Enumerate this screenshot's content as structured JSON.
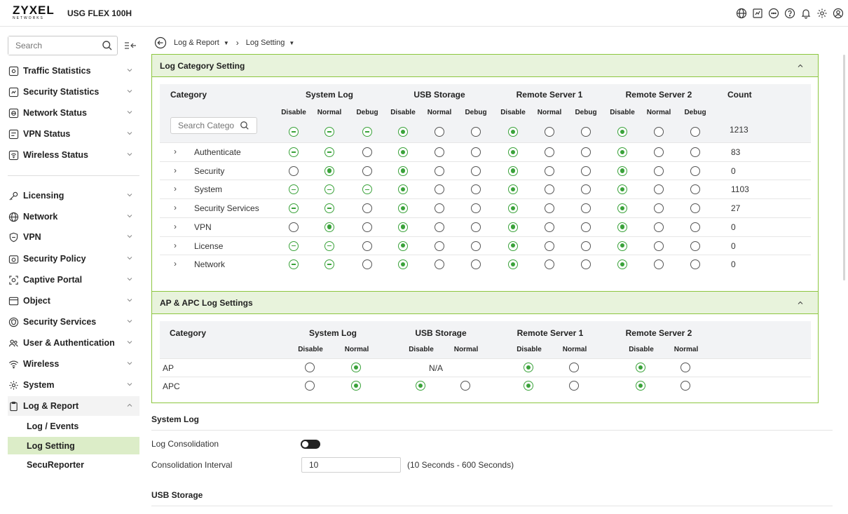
{
  "header": {
    "brand": "ZYXEL",
    "brand_sub": "NETWORKS",
    "model": "USG FLEX 100H",
    "icons": [
      "globe-icon",
      "terminal-icon",
      "chat-icon",
      "help-icon",
      "bell-icon",
      "gear-icon",
      "user-icon"
    ]
  },
  "sidebar": {
    "search_placeholder": "Search",
    "monitor_items": [
      {
        "label": "Traffic Statistics",
        "icon": "chart-icon"
      },
      {
        "label": "Security Statistics",
        "icon": "shield-chart-icon"
      },
      {
        "label": "Network Status",
        "icon": "network-status-icon"
      },
      {
        "label": "VPN Status",
        "icon": "vpn-status-icon"
      },
      {
        "label": "Wireless Status",
        "icon": "wireless-status-icon"
      }
    ],
    "config_items": [
      {
        "label": "Licensing",
        "icon": "key-icon"
      },
      {
        "label": "Network",
        "icon": "globe-icon"
      },
      {
        "label": "VPN",
        "icon": "vpn-shield-icon"
      },
      {
        "label": "Security Policy",
        "icon": "policy-icon"
      },
      {
        "label": "Captive Portal",
        "icon": "portal-icon"
      },
      {
        "label": "Object",
        "icon": "object-icon"
      },
      {
        "label": "Security Services",
        "icon": "security-services-icon"
      },
      {
        "label": "User & Authentication",
        "icon": "users-icon"
      },
      {
        "label": "Wireless",
        "icon": "wifi-icon"
      },
      {
        "label": "System",
        "icon": "system-gear-icon"
      },
      {
        "label": "Log & Report",
        "icon": "clipboard-icon"
      }
    ],
    "log_sub_items": [
      "Log / Events",
      "Log Setting",
      "SecuReporter"
    ],
    "active_sub": "Log Setting"
  },
  "breadcrumb": {
    "level1": "Log & Report",
    "level2": "Log Setting"
  },
  "log_category_panel": {
    "title": "Log Category Setting",
    "col_category": "Category",
    "groups": [
      "System Log",
      "USB Storage",
      "Remote Server 1",
      "Remote Server 2"
    ],
    "sub_cols": [
      "Disable",
      "Normal",
      "Debug"
    ],
    "col_count": "Count",
    "search_placeholder": "Search Catego",
    "all_row": {
      "states": [
        "partial",
        "partial",
        "partial",
        "selected",
        "empty",
        "empty",
        "selected",
        "empty",
        "empty",
        "selected",
        "empty",
        "empty"
      ],
      "count": "1213"
    },
    "rows": [
      {
        "name": "Authenticate",
        "states": [
          "partial",
          "partial",
          "empty",
          "selected",
          "empty",
          "empty",
          "selected",
          "empty",
          "empty",
          "selected",
          "empty",
          "empty"
        ],
        "count": "83"
      },
      {
        "name": "Security",
        "states": [
          "empty",
          "selected",
          "empty",
          "selected",
          "empty",
          "empty",
          "selected",
          "empty",
          "empty",
          "selected",
          "empty",
          "empty"
        ],
        "count": "0"
      },
      {
        "name": "System",
        "states": [
          "partial",
          "partial",
          "partial",
          "selected",
          "empty",
          "empty",
          "selected",
          "empty",
          "empty",
          "selected",
          "empty",
          "empty"
        ],
        "count": "1103"
      },
      {
        "name": "Security Services",
        "states": [
          "partial",
          "partial",
          "empty",
          "selected",
          "empty",
          "empty",
          "selected",
          "empty",
          "empty",
          "selected",
          "empty",
          "empty"
        ],
        "count": "27"
      },
      {
        "name": "VPN",
        "states": [
          "empty",
          "selected",
          "empty",
          "selected",
          "empty",
          "empty",
          "selected",
          "empty",
          "empty",
          "selected",
          "empty",
          "empty"
        ],
        "count": "0"
      },
      {
        "name": "License",
        "states": [
          "partial",
          "partial",
          "empty",
          "selected",
          "empty",
          "empty",
          "selected",
          "empty",
          "empty",
          "selected",
          "empty",
          "empty"
        ],
        "count": "0"
      },
      {
        "name": "Network",
        "states": [
          "partial",
          "partial",
          "empty",
          "selected",
          "empty",
          "empty",
          "selected",
          "empty",
          "empty",
          "selected",
          "empty",
          "empty"
        ],
        "count": "0"
      }
    ]
  },
  "ap_panel": {
    "title": "AP & APC Log Settings",
    "col_category": "Category",
    "groups": [
      "System Log",
      "USB Storage",
      "Remote Server 1",
      "Remote Server 2"
    ],
    "sub_cols": [
      "Disable",
      "Normal"
    ],
    "na_text": "N/A",
    "rows": [
      {
        "name": "AP",
        "states": [
          "empty",
          "selected",
          "na",
          "na",
          "selected",
          "empty",
          "selected",
          "empty"
        ]
      },
      {
        "name": "APC",
        "states": [
          "empty",
          "selected",
          "selected",
          "empty",
          "selected",
          "empty",
          "selected",
          "empty"
        ]
      }
    ]
  },
  "system_log": {
    "title": "System Log",
    "consolidation_label": "Log Consolidation",
    "consolidation_enabled": false,
    "interval_label": "Consolidation Interval",
    "interval_value": "10",
    "interval_hint": "(10 Seconds - 600 Seconds)"
  },
  "usb_storage": {
    "title": "USB Storage"
  }
}
